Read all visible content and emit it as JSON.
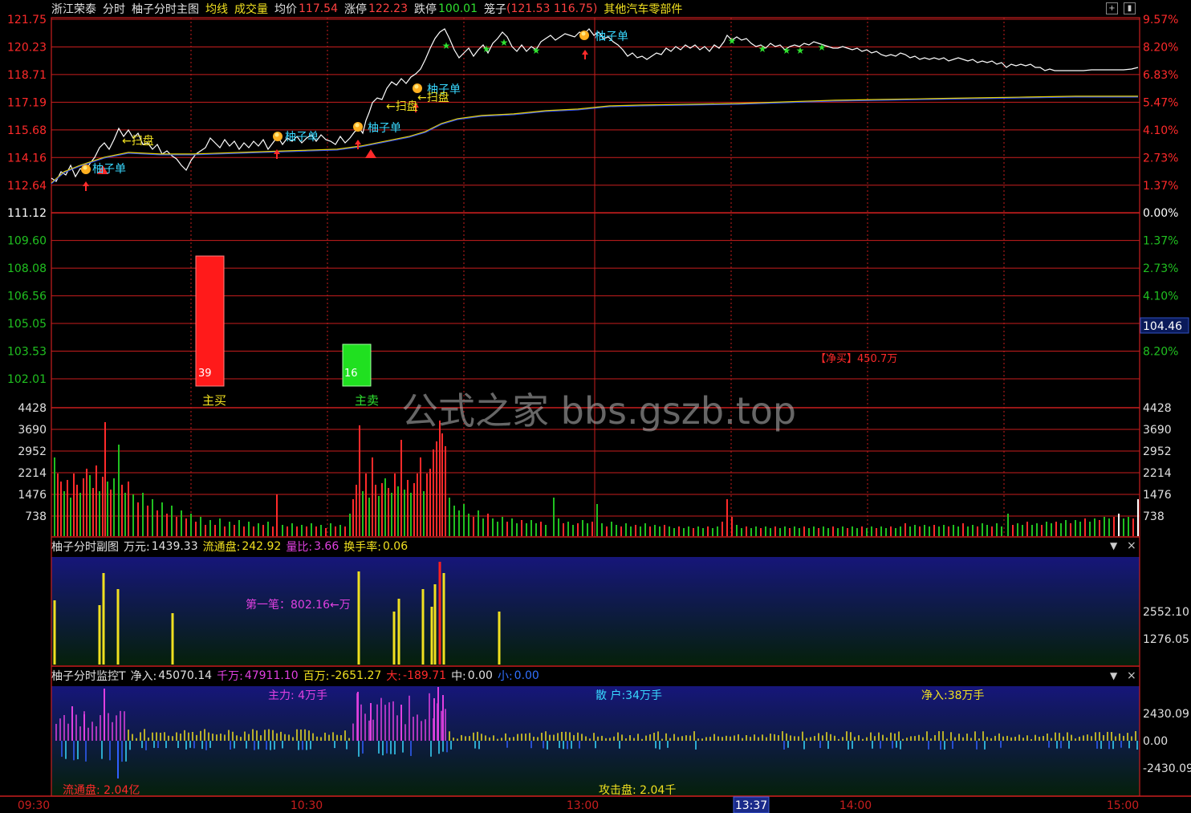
{
  "header": {
    "stock_name": "浙江荣泰",
    "mode": "分时",
    "indicator": "柚子分时主图",
    "avg_line_label": "均线",
    "volume_label": "成交量",
    "avg_price_label": "均价",
    "avg_price": "117.54",
    "limit_up_label": "涨停",
    "limit_up": "122.23",
    "limit_down_label": "跌停",
    "limit_down": "100.01",
    "cage_label": "笼子",
    "cage_value": "(121.53 116.75)",
    "sector": "其他汽车零部件"
  },
  "price_axis_left": [
    "121.75",
    "120.23",
    "118.71",
    "117.19",
    "115.68",
    "114.16",
    "112.64",
    "111.12",
    "109.60",
    "108.08",
    "106.56",
    "105.05",
    "103.53",
    "102.01"
  ],
  "pct_axis_right": [
    "9.57%",
    "8.20%",
    "6.83%",
    "5.47%",
    "4.10%",
    "2.73%",
    "1.37%",
    "0.00%",
    "1.37%",
    "2.73%",
    "4.10%",
    "6.83%",
    "8.20%"
  ],
  "price_tag_right": "104.46",
  "volume_axis": [
    "4428",
    "3690",
    "2952",
    "2214",
    "1476",
    "738"
  ],
  "time_axis": [
    "09:30",
    "10:30",
    "13:00",
    "14:00",
    "15:00"
  ],
  "cursor_time": "13:37",
  "main_annotations": {
    "yuzi_order": "柚子单",
    "sweep": "←扫盘",
    "net_buy": "【净买】450.7万",
    "bar_buy_value": "39",
    "bar_buy_label": "主买",
    "bar_sell_value": "16",
    "bar_sell_label": "主卖"
  },
  "watermark": "公式之家 bbs.gszb.top",
  "panel2": {
    "title": "柚子分时副图",
    "wanyuan_label": "万元:",
    "wanyuan": "1439.33",
    "float_label": "流通盘:",
    "float": "242.92",
    "ratio_label": "量比:",
    "ratio": "3.66",
    "turnover_label": "换手率:",
    "turnover": "0.06",
    "first_trade": "第一笔：802.16←万",
    "axis": [
      "2552.10",
      "1276.05"
    ]
  },
  "panel3": {
    "title": "柚子分时监控T",
    "net_in_label": "净入:",
    "net_in": "45070.14",
    "qianwan_label": "千万:",
    "qianwan": "47911.10",
    "baiwan_label": "百万:",
    "baiwan": "-2651.27",
    "da_label": "大:",
    "da": "-189.71",
    "zhong_label": "中:",
    "zhong": "0.00",
    "xiao_label": "小:",
    "xiao": "0.00",
    "main_force": "主力: 4万手",
    "retail": "散 户:34万手",
    "net_inflow": "净入:38万手",
    "float_cap": "流通盘: 2.04亿",
    "attack": "攻击盘: 2.04千",
    "axis": [
      "2430.09",
      "0.00",
      "-2430.09"
    ]
  },
  "colors": {
    "grid": "#c81e1e",
    "price_line": "#ffffff",
    "avg_line": "#e6d200",
    "up": "#ff2a2a",
    "down": "#20c020",
    "cyan": "#38d8ff",
    "magenta": "#e040e0",
    "yellow": "#f0e020"
  }
}
